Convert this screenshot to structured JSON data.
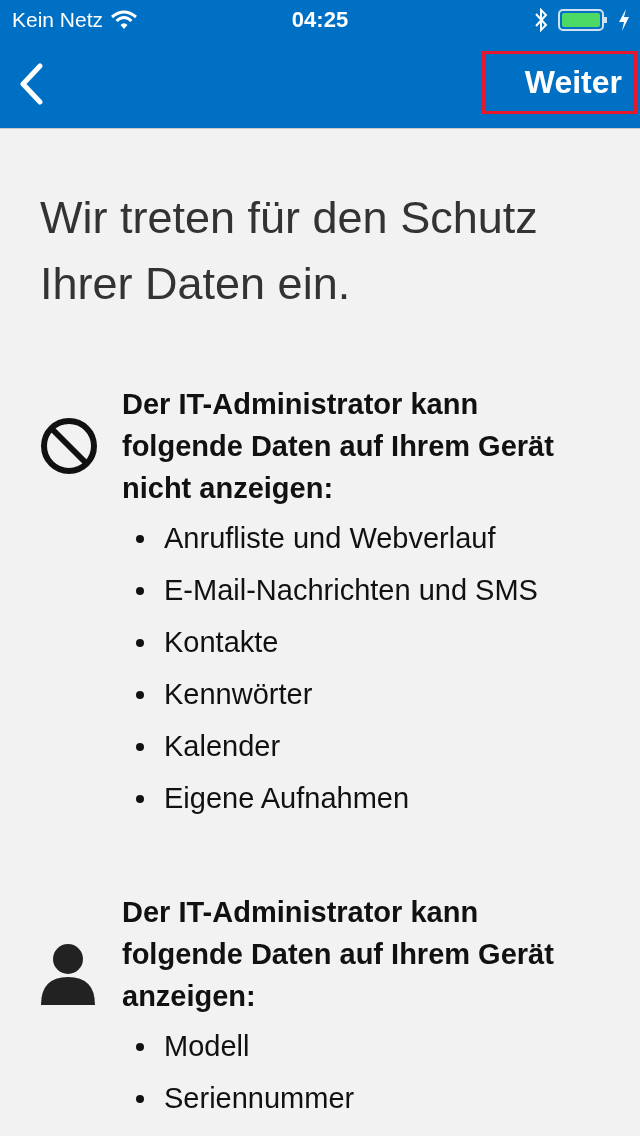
{
  "status_bar": {
    "carrier": "Kein Netz",
    "time": "04:25"
  },
  "nav_bar": {
    "next_button": {
      "label": "Weiter",
      "highlighted": true
    }
  },
  "title": "Wir treten für den Schutz Ihrer Daten ein.",
  "sections": [
    {
      "kind": "blocked",
      "heading": "Der IT-Administrator kann folgende Daten auf Ihrem Gerät nicht anzeigen:",
      "items": [
        "Anrufliste und Webverlauf",
        "E-Mail-Nachrichten und SMS",
        "Kontakte",
        "Kennwörter",
        "Kalender",
        "Eigene Aufnahmen"
      ]
    },
    {
      "kind": "person",
      "heading": "Der IT-Administrator kann folgende Daten auf Ihrem Gerät anzeigen:",
      "items": [
        "Modell",
        "Seriennummer"
      ]
    }
  ]
}
